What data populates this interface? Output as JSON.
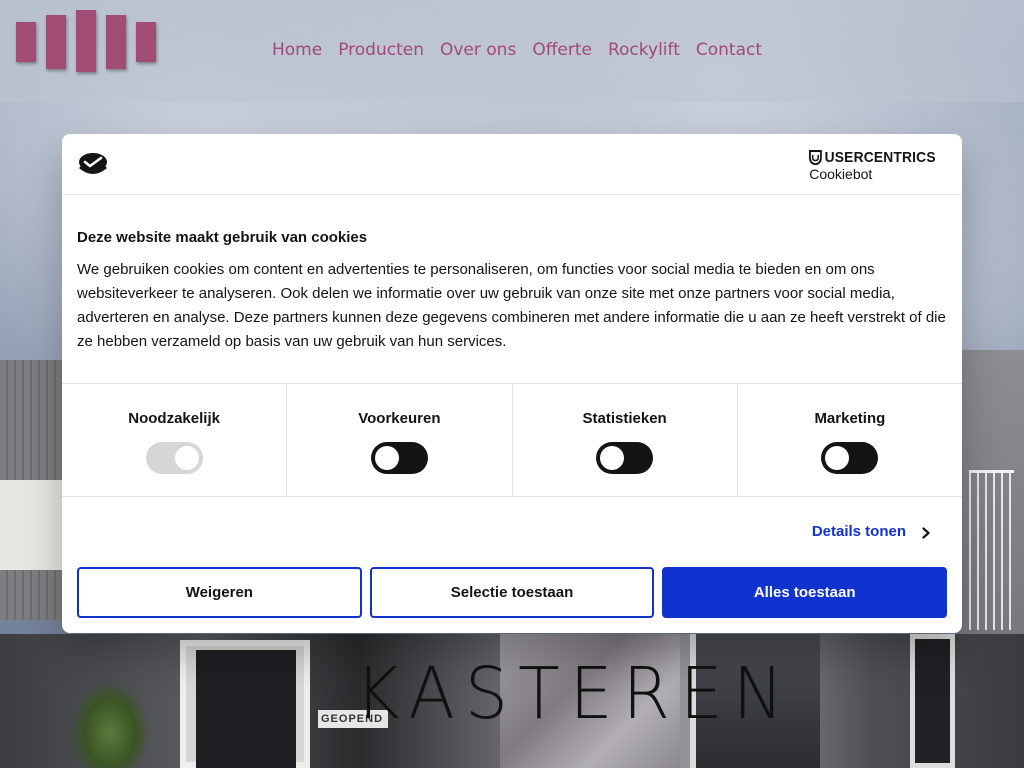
{
  "header": {
    "nav": [
      "Home",
      "Producten",
      "Over ons",
      "Offerte",
      "Rockylift",
      "Contact"
    ],
    "accent_color": "#a0497a"
  },
  "hero": {
    "brand_word": "KASTEREN",
    "shop_sign": "GEOPEND"
  },
  "cookie_dialog": {
    "provider_name": "USERCENTRICS",
    "provider_product": "Cookiebot",
    "title": "Deze website maakt gebruik van cookies",
    "description": "We gebruiken cookies om content en advertenties te personaliseren, om functies voor social media te bieden en om ons websiteverkeer te analyseren. Ook delen we informatie over uw gebruik van onze site met onze partners voor social media, adverteren en analyse. Deze partners kunnen deze gegevens combineren met andere informatie die u aan ze heeft verstrekt of die ze hebben verzameld op basis van uw gebruik van hun services.",
    "categories": [
      {
        "label": "Noodzakelijk",
        "state": "on",
        "disabled": true
      },
      {
        "label": "Voorkeuren",
        "state": "off",
        "disabled": false
      },
      {
        "label": "Statistieken",
        "state": "off",
        "disabled": false
      },
      {
        "label": "Marketing",
        "state": "off",
        "disabled": false
      }
    ],
    "details_link": "Details tonen",
    "buttons": {
      "deny": "Weigeren",
      "selection": "Selectie toestaan",
      "allow_all": "Alles toestaan"
    },
    "brand_color": "#1032cf"
  }
}
